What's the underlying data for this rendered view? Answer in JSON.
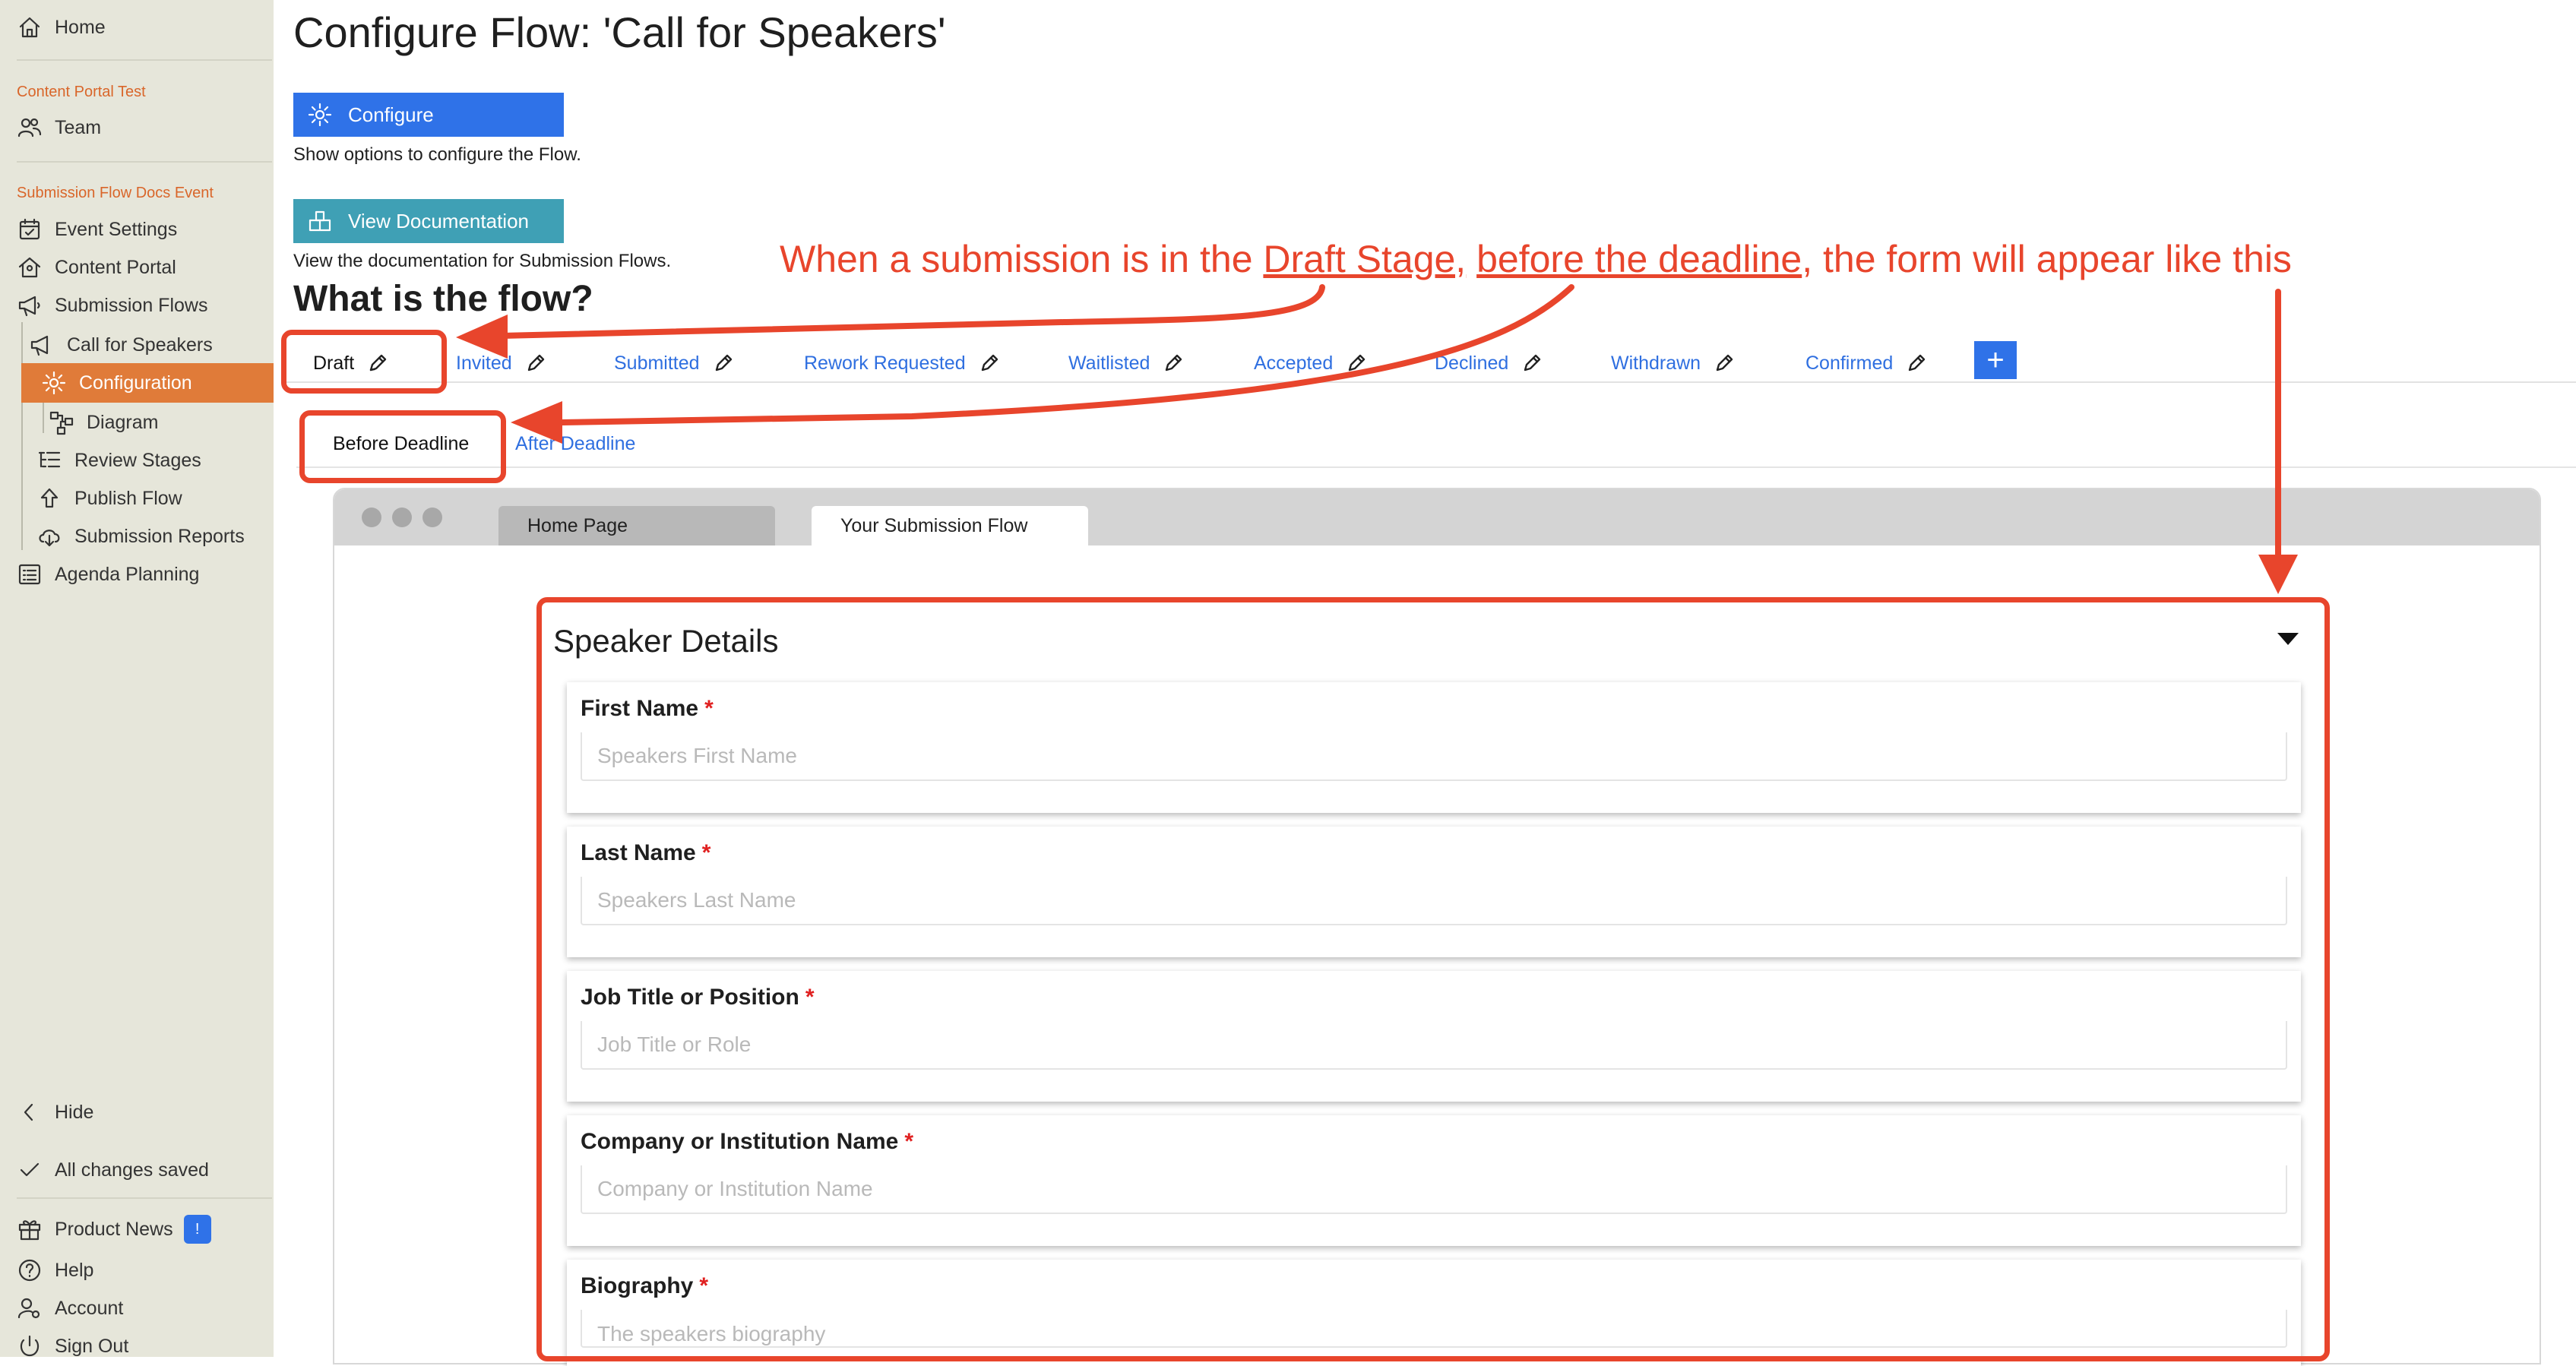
{
  "sidebar": {
    "home": "Home",
    "section_org": "Content Portal Test",
    "team": "Team",
    "section_event": "Submission Flow Docs Event",
    "event_settings": "Event Settings",
    "content_portal": "Content Portal",
    "submission_flows": "Submission Flows",
    "call_for_speakers": "Call for Speakers",
    "configuration": "Configuration",
    "diagram": "Diagram",
    "review_stages": "Review Stages",
    "publish_flow": "Publish Flow",
    "submission_reports": "Submission Reports",
    "agenda_planning": "Agenda Planning",
    "hide": "Hide",
    "save_status": "All changes saved",
    "product_news": "Product News",
    "product_news_badge": "!",
    "help": "Help",
    "account": "Account",
    "sign_out": "Sign Out"
  },
  "header": {
    "title": "Configure Flow: 'Call for Speakers'",
    "configure_label": "Configure",
    "configure_help": "Show options to configure the Flow.",
    "docs_label": "View Documentation",
    "docs_help": "View the documentation for Submission Flows.",
    "flow_heading": "What is the flow?"
  },
  "stages": [
    {
      "label": "Draft"
    },
    {
      "label": "Invited"
    },
    {
      "label": "Submitted"
    },
    {
      "label": "Rework Requested"
    },
    {
      "label": "Waitlisted"
    },
    {
      "label": "Accepted"
    },
    {
      "label": "Declined"
    },
    {
      "label": "Withdrawn"
    },
    {
      "label": "Confirmed"
    }
  ],
  "add_stage_label": "+",
  "subtabs": [
    {
      "label": "Before Deadline"
    },
    {
      "label": "After Deadline"
    }
  ],
  "browser": {
    "tab_home": "Home Page",
    "tab_flow": "Your Submission Flow"
  },
  "form": {
    "title": "Speaker Details",
    "required_marker": "*",
    "fields": [
      {
        "label": "First Name",
        "placeholder": "Speakers First Name"
      },
      {
        "label": "Last Name",
        "placeholder": "Speakers Last Name"
      },
      {
        "label": "Job Title or Position",
        "placeholder": "Job Title or Role"
      },
      {
        "label": "Company or Institution Name",
        "placeholder": "Company or Institution Name"
      },
      {
        "label": "Biography",
        "placeholder": "The speakers biography"
      }
    ]
  },
  "annotation": {
    "part1": "When a submission is in the ",
    "part2": "Draft Stage,",
    "part3": " ",
    "part4": "before the deadline",
    "part5": ", the form will appear like this"
  },
  "colors": {
    "accent_orange": "#e07b39",
    "primary_blue": "#2f72e8",
    "docs_teal": "#3fa0b5",
    "annotation_red": "#e8452c",
    "sidebar_bg": "#e6e6da"
  }
}
